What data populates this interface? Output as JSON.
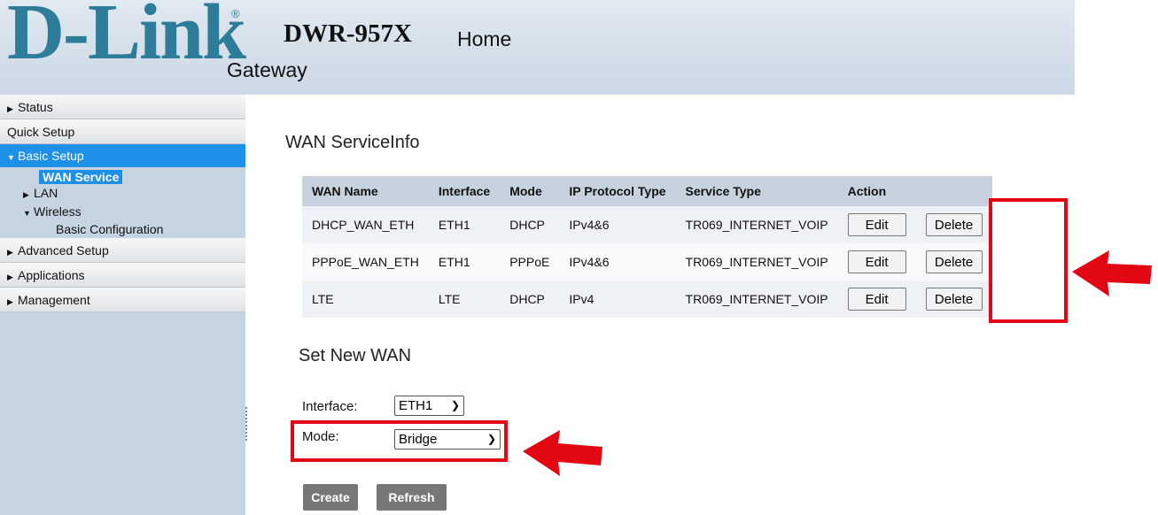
{
  "header": {
    "logo": "D-Link",
    "logo_mark": "®",
    "model": "DWR-957X",
    "page": "Home",
    "subtitle": "Gateway"
  },
  "sidebar": {
    "status": "Status",
    "quick_setup": "Quick Setup",
    "basic_setup": "Basic Setup",
    "wan_service": "WAN Service",
    "lan": "LAN",
    "wireless": "Wireless",
    "basic_configuration": "Basic Configuration",
    "advanced_setup": "Advanced Setup",
    "applications": "Applications",
    "management": "Management"
  },
  "wan_info": {
    "title": "WAN ServiceInfo",
    "headers": [
      "WAN Name",
      "Interface",
      "Mode",
      "IP Protocol Type",
      "Service Type",
      "Action"
    ],
    "rows": [
      {
        "name": "DHCP_WAN_ETH",
        "interface": "ETH1",
        "mode": "DHCP",
        "ip_type": "IPv4&6",
        "service": "TR069_INTERNET_VOIP"
      },
      {
        "name": "PPPoE_WAN_ETH",
        "interface": "ETH1",
        "mode": "PPPoE",
        "ip_type": "IPv4&6",
        "service": "TR069_INTERNET_VOIP"
      },
      {
        "name": "LTE",
        "interface": "LTE",
        "mode": "DHCP",
        "ip_type": "IPv4",
        "service": "TR069_INTERNET_VOIP"
      }
    ],
    "edit_label": "Edit",
    "delete_label": "Delete"
  },
  "set_new_wan": {
    "title": "Set New WAN",
    "interface_label": "Interface:",
    "interface_value": "ETH1",
    "mode_label": "Mode:",
    "mode_value": "Bridge",
    "create_label": "Create",
    "refresh_label": "Refresh"
  },
  "colors": {
    "accent": "#1e90e8",
    "annotation": "#e30613",
    "logo": "#2c7c9a"
  }
}
